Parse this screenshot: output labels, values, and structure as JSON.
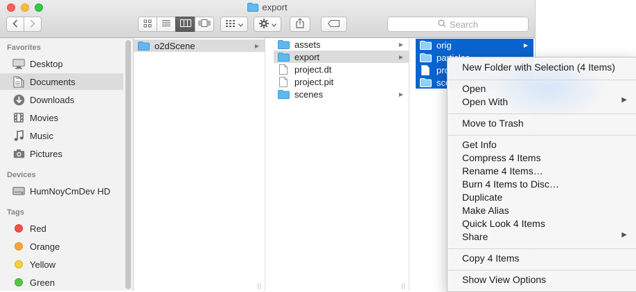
{
  "window": {
    "title": "export"
  },
  "toolbar": {
    "search_placeholder": "Search"
  },
  "sidebar": {
    "favorites_header": "Favorites",
    "favorites": [
      {
        "label": "Desktop",
        "icon": "desktop-icon"
      },
      {
        "label": "Documents",
        "icon": "documents-icon",
        "selected": true
      },
      {
        "label": "Downloads",
        "icon": "downloads-icon"
      },
      {
        "label": "Movies",
        "icon": "movies-icon"
      },
      {
        "label": "Music",
        "icon": "music-icon"
      },
      {
        "label": "Pictures",
        "icon": "pictures-icon"
      }
    ],
    "devices_header": "Devices",
    "devices": [
      {
        "label": "HumNoyCmDev HD",
        "icon": "hard-drive-icon"
      }
    ],
    "tags_header": "Tags",
    "tags": [
      {
        "label": "Red",
        "color": "#f2514b"
      },
      {
        "label": "Orange",
        "color": "#f7a43b"
      },
      {
        "label": "Yellow",
        "color": "#f3cf42"
      },
      {
        "label": "Green",
        "color": "#5bc34a"
      }
    ]
  },
  "columns": {
    "col1": [
      {
        "name": "o2dScene",
        "type": "folder",
        "selected": "gray"
      }
    ],
    "col2": [
      {
        "name": "assets",
        "type": "folder"
      },
      {
        "name": "export",
        "type": "folder",
        "selected": "gray"
      },
      {
        "name": "project.dt",
        "type": "file"
      },
      {
        "name": "project.pit",
        "type": "file"
      },
      {
        "name": "scenes",
        "type": "folder"
      }
    ],
    "col3": [
      {
        "name": "orig",
        "type": "folder"
      },
      {
        "name": "particles",
        "type": "folder"
      },
      {
        "name": "pro",
        "type": "file"
      },
      {
        "name": "sce",
        "type": "folder"
      }
    ]
  },
  "context_menu": {
    "groups": [
      [
        {
          "label": "New Folder with Selection (4 Items)"
        }
      ],
      [
        {
          "label": "Open"
        },
        {
          "label": "Open With",
          "submenu": true
        }
      ],
      [
        {
          "label": "Move to Trash"
        }
      ],
      [
        {
          "label": "Get Info"
        },
        {
          "label": "Compress 4 Items"
        },
        {
          "label": "Rename 4 Items…"
        },
        {
          "label": "Burn 4 Items to Disc…"
        },
        {
          "label": "Duplicate"
        },
        {
          "label": "Make Alias"
        },
        {
          "label": "Quick Look 4 Items"
        },
        {
          "label": "Share",
          "submenu": true
        }
      ],
      [
        {
          "label": "Copy 4 Items"
        }
      ],
      [
        {
          "label": "Show View Options"
        }
      ]
    ],
    "submenu_glyph": "▶"
  },
  "colors": {
    "selection_blue": "#0a64d0",
    "folder_blue": "#5fb8ef",
    "sidebar_bg": "#f2f2f2"
  }
}
